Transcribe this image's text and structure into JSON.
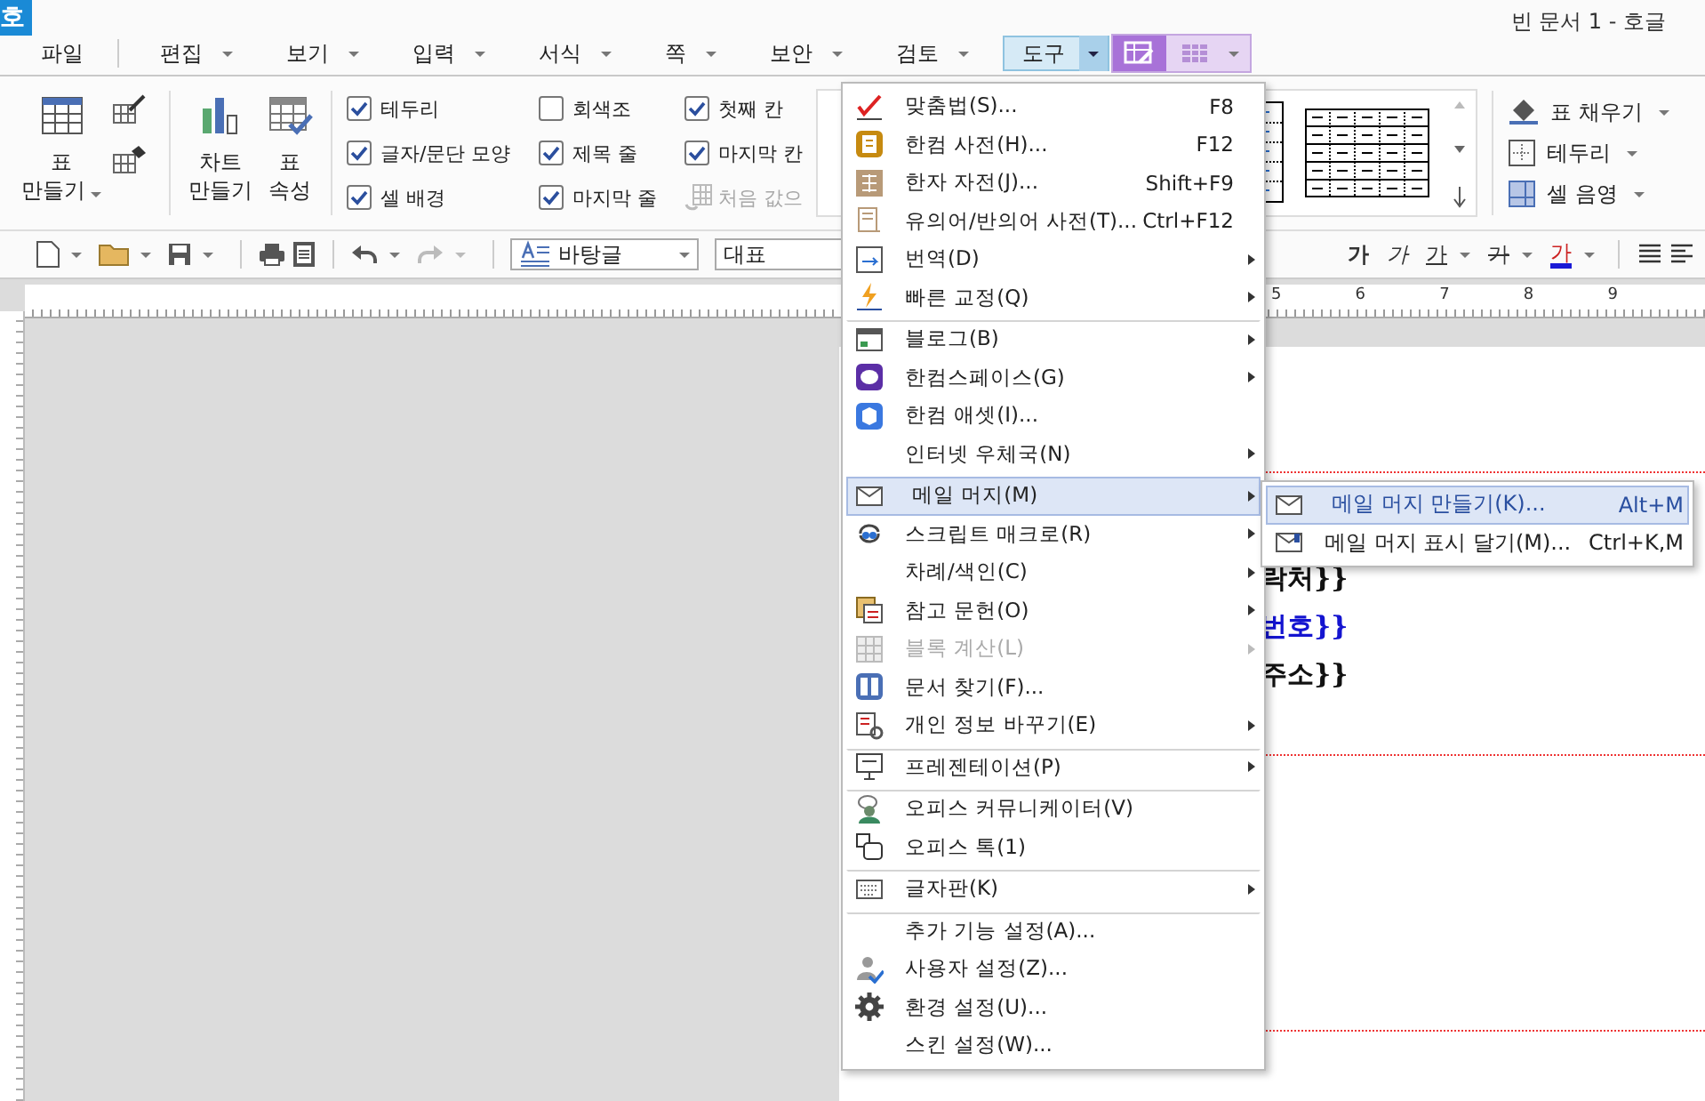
{
  "window": {
    "logo": "호",
    "title": "빈 문서 1 - 호글"
  },
  "menubar": [
    {
      "label": "파일",
      "dropdown": false,
      "selected": false
    },
    {
      "label": "편집",
      "dropdown": true,
      "selected": false
    },
    {
      "label": "보기",
      "dropdown": true,
      "selected": false
    },
    {
      "label": "입력",
      "dropdown": true,
      "selected": false
    },
    {
      "label": "서식",
      "dropdown": true,
      "selected": false
    },
    {
      "label": "쪽",
      "dropdown": true,
      "selected": false
    },
    {
      "label": "보안",
      "dropdown": true,
      "selected": false
    },
    {
      "label": "검토",
      "dropdown": true,
      "selected": false
    },
    {
      "label": "도구",
      "dropdown": true,
      "selected": true
    }
  ],
  "ribbon": {
    "big_buttons": [
      {
        "lines": [
          "표",
          "만들기"
        ],
        "dropdown": true
      },
      {
        "lines": [
          "차트",
          "만들기"
        ],
        "dropdown": false
      },
      {
        "lines": [
          "표",
          "속성"
        ],
        "dropdown": false
      }
    ],
    "options": [
      {
        "label": "테두리",
        "kind": "checkbox",
        "checked": true
      },
      {
        "label": "글자/문단 모양",
        "kind": "checkbox",
        "checked": true
      },
      {
        "label": "셀 배경",
        "kind": "checkbox",
        "checked": true
      },
      {
        "label": "회색조",
        "kind": "checkbox",
        "checked": false
      },
      {
        "label": "제목 줄",
        "kind": "checkbox",
        "checked": true
      },
      {
        "label": "마지막 줄",
        "kind": "checkbox",
        "checked": true
      },
      {
        "label": "첫째 칸",
        "kind": "checkbox",
        "checked": true
      },
      {
        "label": "마지막 칸",
        "kind": "checkbox",
        "checked": true
      },
      {
        "label": "처음 값으",
        "kind": "button",
        "disabled": true
      }
    ],
    "right_buttons": [
      {
        "label": "표 채우기"
      },
      {
        "label": "테두리"
      },
      {
        "label": "셀 음영"
      }
    ]
  },
  "toolbar": {
    "style": "바탕글",
    "font": "대표",
    "format_buttons": [
      {
        "label": "가",
        "kind": "bold",
        "dropdown": false
      },
      {
        "label": "가",
        "kind": "italic",
        "dropdown": false
      },
      {
        "label": "가",
        "kind": "underline",
        "dropdown": true
      },
      {
        "label": "가",
        "kind": "strike",
        "dropdown": true
      },
      {
        "label": "가",
        "kind": "color",
        "dropdown": true
      }
    ]
  },
  "ruler": {
    "numbers": [
      "5",
      "6",
      "7",
      "8",
      "9"
    ]
  },
  "document": {
    "lines": [
      {
        "text": "락처}}",
        "kind": "plain"
      },
      {
        "text": "번호}}",
        "kind": "field"
      },
      {
        "text": "주소}}",
        "kind": "plain"
      }
    ]
  },
  "tools_menu": [
    {
      "label": "맞춤법(S)...",
      "shortcut": "F8",
      "submenu": false,
      "disabled": false,
      "selected": false,
      "separator_before": false
    },
    {
      "label": "한컴 사전(H)...",
      "shortcut": "F12",
      "submenu": false,
      "disabled": false,
      "selected": false,
      "separator_before": false
    },
    {
      "label": "한자 자전(J)...",
      "shortcut": "Shift+F9",
      "submenu": false,
      "disabled": false,
      "selected": false,
      "separator_before": false
    },
    {
      "label": "유의어/반의어 사전(T)...",
      "shortcut": "Ctrl+F12",
      "submenu": false,
      "disabled": false,
      "selected": false,
      "separator_before": false
    },
    {
      "label": "번역(D)",
      "submenu": true,
      "disabled": false,
      "selected": false,
      "separator_before": false
    },
    {
      "label": "빠른 교정(Q)",
      "submenu": true,
      "disabled": false,
      "selected": false,
      "separator_before": false
    },
    {
      "label": "블로그(B)",
      "submenu": true,
      "disabled": false,
      "selected": false,
      "separator_before": true
    },
    {
      "label": "한컴스페이스(G)",
      "submenu": true,
      "disabled": false,
      "selected": false,
      "separator_before": false
    },
    {
      "label": "한컴 애셋(I)...",
      "submenu": false,
      "disabled": false,
      "selected": false,
      "separator_before": false
    },
    {
      "label": "인터넷 우체국(N)",
      "submenu": true,
      "disabled": false,
      "selected": false,
      "separator_before": false
    },
    {
      "label": "메일 머지(M)",
      "submenu": true,
      "disabled": false,
      "selected": true,
      "separator_before": true
    },
    {
      "label": "스크립트 매크로(R)",
      "submenu": true,
      "disabled": false,
      "selected": false,
      "separator_before": false
    },
    {
      "label": "차례/색인(C)",
      "submenu": true,
      "disabled": false,
      "selected": false,
      "separator_before": false
    },
    {
      "label": "참고 문헌(O)",
      "submenu": true,
      "disabled": false,
      "selected": false,
      "separator_before": false
    },
    {
      "label": "블록 계산(L)",
      "submenu": true,
      "disabled": true,
      "selected": false,
      "separator_before": false
    },
    {
      "label": "문서 찾기(F)...",
      "submenu": false,
      "disabled": false,
      "selected": false,
      "separator_before": false
    },
    {
      "label": "개인 정보 바꾸기(E)",
      "submenu": true,
      "disabled": false,
      "selected": false,
      "separator_before": false
    },
    {
      "label": "프레젠테이션(P)",
      "submenu": true,
      "disabled": false,
      "selected": false,
      "separator_before": true
    },
    {
      "label": "오피스 커뮤니케이터(V)",
      "submenu": false,
      "disabled": false,
      "selected": false,
      "separator_before": true
    },
    {
      "label": "오피스 톡(1)",
      "submenu": false,
      "disabled": false,
      "selected": false,
      "separator_before": false
    },
    {
      "label": "글자판(K)",
      "submenu": true,
      "disabled": false,
      "selected": false,
      "separator_before": true
    },
    {
      "label": "추가 기능 설정(A)...",
      "submenu": false,
      "disabled": false,
      "selected": false,
      "separator_before": true
    },
    {
      "label": "사용자 설정(Z)...",
      "submenu": false,
      "disabled": false,
      "selected": false,
      "separator_before": false
    },
    {
      "label": "환경 설정(U)...",
      "submenu": false,
      "disabled": false,
      "selected": false,
      "separator_before": false
    },
    {
      "label": "스킨 설정(W)...",
      "submenu": false,
      "disabled": false,
      "selected": false,
      "separator_before": false
    }
  ],
  "mail_merge_submenu": [
    {
      "label": "메일 머지 만들기(K)...",
      "shortcut": "Alt+M",
      "selected": true
    },
    {
      "label": "메일 머지 표시 달기(M)...",
      "shortcut": "Ctrl+K,M",
      "selected": false
    }
  ]
}
